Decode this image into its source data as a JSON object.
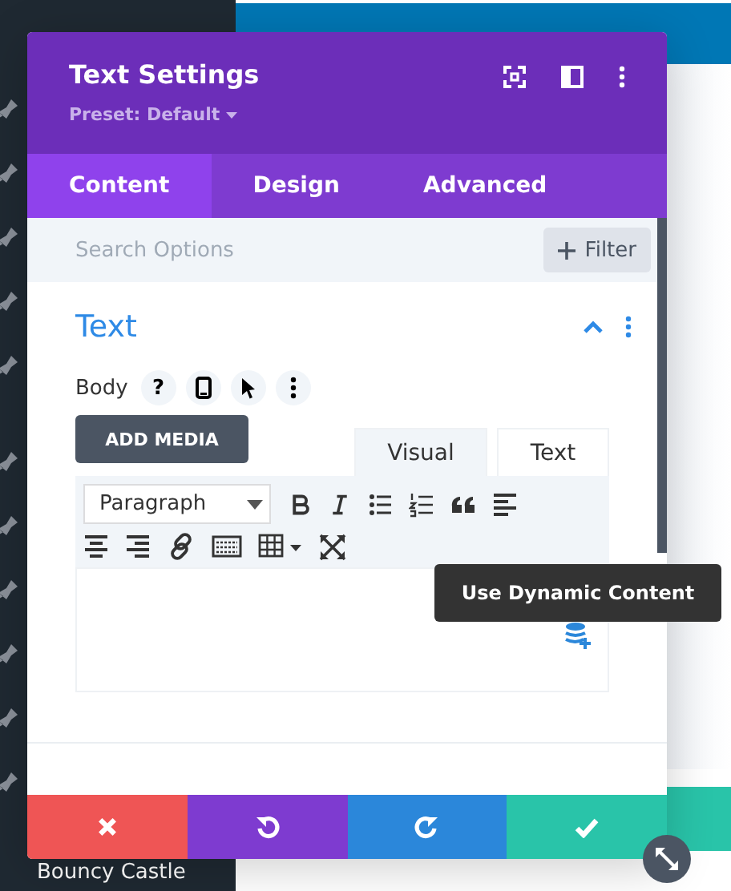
{
  "page": {
    "sidebar_item": "Bouncy Castle"
  },
  "modal": {
    "title": "Text Settings",
    "preset": "Preset: Default",
    "tabs": [
      {
        "label": "Content",
        "selected": true
      },
      {
        "label": "Design",
        "selected": false
      },
      {
        "label": "Advanced",
        "selected": false
      }
    ],
    "search": {
      "placeholder": "Search Options"
    },
    "filter_button": "Filter",
    "section": {
      "title": "Text",
      "expanded": true,
      "field_label": "Body",
      "help_button": "?",
      "add_media_button": "ADD MEDIA",
      "editor_tabs": [
        {
          "label": "Visual",
          "selected": true
        },
        {
          "label": "Text",
          "selected": false
        }
      ],
      "format_select": "Paragraph"
    },
    "tooltip": "Use Dynamic Content",
    "footer_buttons": [
      {
        "kind": "cancel",
        "color": "#ef5555"
      },
      {
        "kind": "undo",
        "color": "#7e3bd0"
      },
      {
        "kind": "redo",
        "color": "#2b87da"
      },
      {
        "kind": "save",
        "color": "#29c4a9"
      }
    ]
  }
}
